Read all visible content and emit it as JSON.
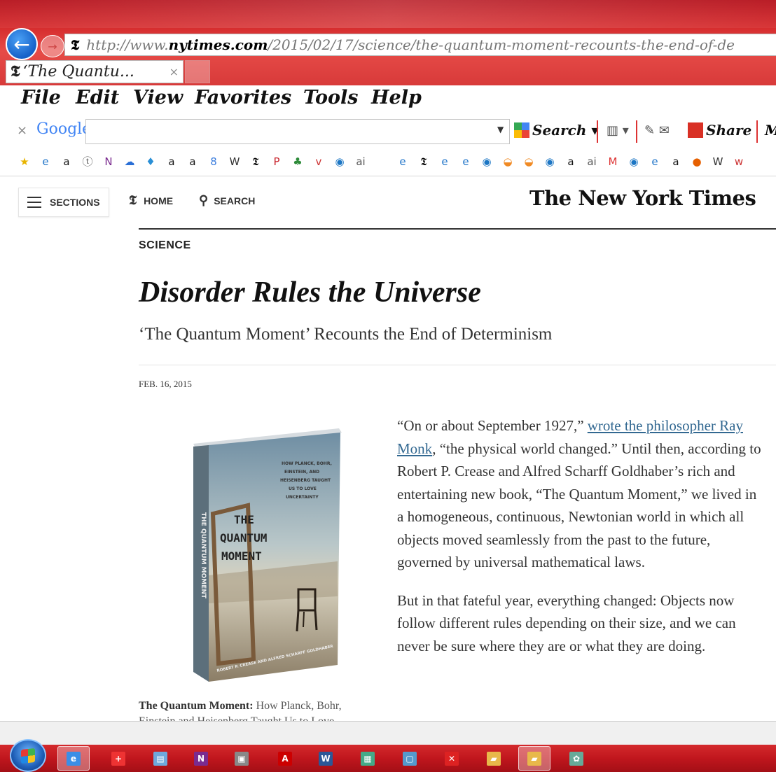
{
  "browser": {
    "url_prefix": "http://www.",
    "url_domain": "nytimes.com",
    "url_path": "/2015/02/17/science/the-quantum-moment-recounts-the-end-of-de",
    "tab_title": "‘The Quantu...",
    "menu": [
      "File",
      "Edit",
      "View",
      "Favorites",
      "Tools",
      "Help"
    ],
    "google_toolbar": {
      "logo": "Google",
      "search_label": "Search",
      "share_label": "Share",
      "more_label": "M"
    },
    "favorites_icons": [
      "star-add-icon",
      "ie-icon",
      "amazon-icon",
      "tan-icon",
      "onenote-icon",
      "cloud-icon",
      "dropper-icon",
      "amazon-icon",
      "amazon-icon",
      "google-icon",
      "wikipedia-icon",
      "nyt-icon",
      "pinterest-icon",
      "tree-icon",
      "vzw-icon",
      "globe-icon",
      "ai-icon",
      "apple-icon",
      "ie-icon",
      "nyt-icon",
      "ie-icon",
      "ie-icon",
      "globe-icon",
      "rainbow-icon",
      "rainbow-icon",
      "globe-icon",
      "amazon-icon",
      "ai-icon",
      "gmail-icon",
      "globe-icon",
      "ie-icon",
      "amazon-icon",
      "firefox-icon",
      "wikipedia-icon",
      "w-icon"
    ]
  },
  "nyt": {
    "sections_label": "SECTIONS",
    "home_label": "HOME",
    "search_label": "SEARCH",
    "masthead": "The New York Times",
    "section": "SCIENCE",
    "headline": "Disorder Rules the Universe",
    "subheadline": "‘The Quantum Moment’ Recounts the End of Determinism",
    "date": "FEB. 16, 2015",
    "book_cover": {
      "top_text": "HOW PLANCK, BOHR, EINSTEIN, AND HEISENBERG TAUGHT US TO LOVE UNCERTAINTY",
      "title_lines": [
        "THE",
        "QUANTUM",
        "MOMENT"
      ],
      "authors": "ROBERT P. CREASE AND ALFRED SCHARFF GOLDHABER",
      "spine": "THE QUANTUM MOMENT"
    },
    "caption_bold": "The Quantum Moment:",
    "caption_text": " How Planck, Bohr, Einstein and Heisenberg Taught Us to Love",
    "paragraphs": [
      {
        "open": "“On or about September 1927,” ",
        "link": "wrote the philosopher Ray Monk",
        "rest": ", “the physical world changed.” Until then, according to Robert P. Crease and Alfred Scharff Goldhaber’s rich and entertaining new book, “The Quantum Moment,” we lived in a homogeneous, continuous, Newtonian world in which all objects moved seamlessly from the past to the future, governed by universal mathematical laws."
      },
      {
        "text": "But in that fateful year, everything changed: Objects now follow different rules depending on their size, and we can never be sure where they are or what they are doing."
      }
    ]
  },
  "taskbar": {
    "items": [
      "internet-explorer-icon",
      "red-cross-icon",
      "notepad-icon",
      "onenote-icon",
      "presentation-icon",
      "acrobat-icon",
      "word-icon",
      "remote-desktop-icon",
      "monitor-icon",
      "x-app-icon",
      "folder-icon",
      "folder-icon",
      "paint-icon"
    ]
  }
}
